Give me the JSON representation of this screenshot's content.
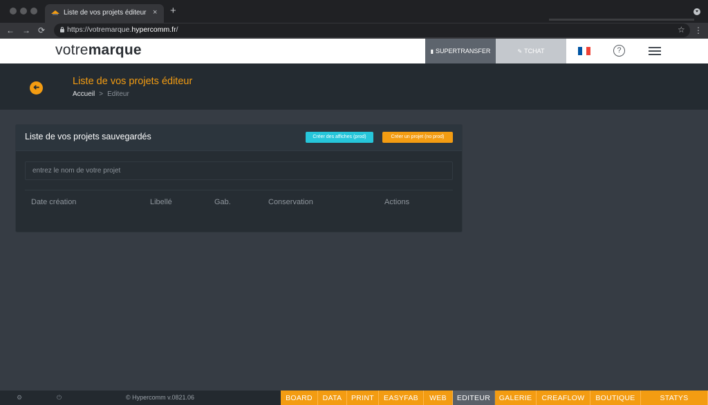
{
  "browser": {
    "tab_title": "Liste de vos projets éditeur - P",
    "tab_close": "×",
    "new_tab": "+",
    "url_prefix": "https://votremarque.",
    "url_domain": "hypercomm.fr",
    "url_suffix": "/",
    "back": "←",
    "forward": "→",
    "reload": "⟳",
    "star": "☆",
    "menu": "⋮"
  },
  "header": {
    "logo_light": "votre",
    "logo_bold": "marque",
    "supertransfer_label": "SUPERTRANSFER",
    "tchat_label": "TCHAT",
    "help_label": "?",
    "flag_colors": [
      "#0055a4",
      "#ffffff",
      "#ef4135"
    ]
  },
  "page": {
    "back_icon": "➜",
    "title": "Liste de vos projets éditeur",
    "breadcrumb": {
      "home": "Accueil",
      "separator": ">",
      "current": "Editeur"
    }
  },
  "card": {
    "title": "Liste de vos projets sauvegardés",
    "btn_posters": "Créer des affiches (prod)",
    "btn_project": "Créer un projet (no prod)",
    "search_placeholder": "entrez le nom de votre projet",
    "columns": [
      "Date création",
      "Libellé",
      "Gab.",
      "Conservation",
      "Actions"
    ]
  },
  "footer": {
    "copyright": "© Hypercomm v.0821.06",
    "settings_icon": "⚙",
    "power_icon": "⏻",
    "nav": [
      "BOARD",
      "DATA",
      "PRINT",
      "EASYFAB",
      "WEB",
      "EDITEUR",
      "GALERIE",
      "CREAFLOW",
      "BOUTIQUE",
      "STATYS"
    ],
    "active_nav": "EDITEUR"
  },
  "colors": {
    "accent": "#f39c12",
    "cyan": "#26c6da",
    "background": "#363c44",
    "header_dark": "#242b31"
  }
}
